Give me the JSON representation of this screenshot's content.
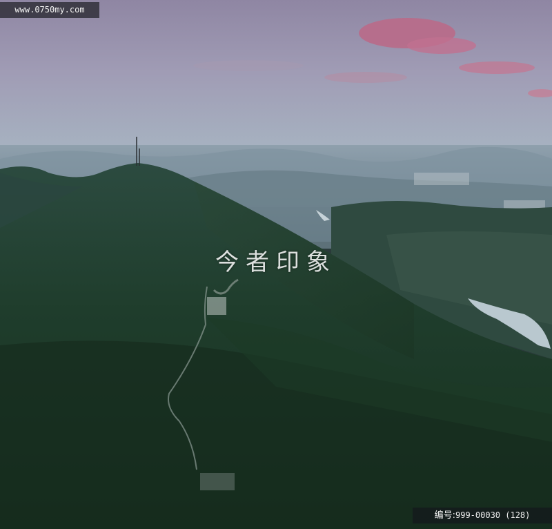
{
  "watermark": {
    "site": "www.0750my.com",
    "center_text": "今者印象",
    "id_label": "编号:",
    "id_value": "999-00030 (128)"
  },
  "colors": {
    "sky_top": "#9a8aa6",
    "sky_horizon": "#a9b6c4",
    "cloud": "#c96a86",
    "mountain": "#1f4030",
    "forest_dark": "#14281c",
    "water": "#b8c8d0"
  }
}
